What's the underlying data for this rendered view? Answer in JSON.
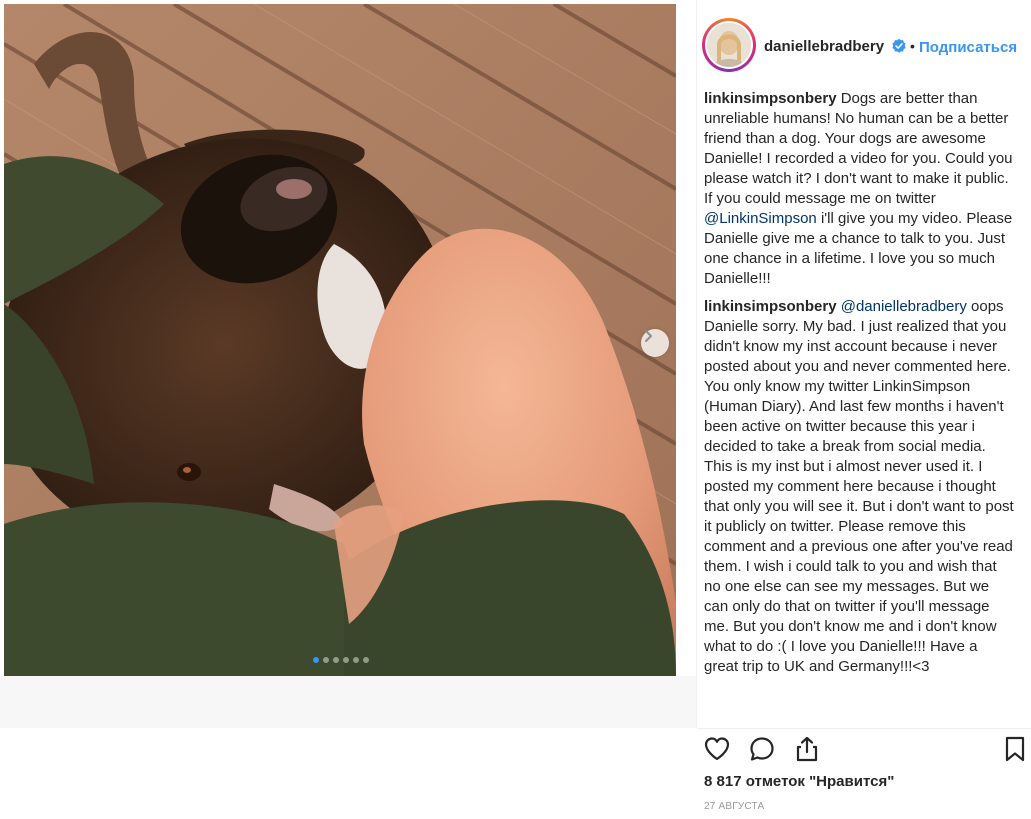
{
  "post": {
    "username": "daniellebradbery",
    "follow_label": "Подписаться",
    "separator": "•",
    "carousel": {
      "slide_count": 6,
      "active_slide": 1
    }
  },
  "comments": [
    {
      "user": "linkinsimpsonbery",
      "text_before": "Dogs are better than unreliable humans! No human can be a better friend than a dog. Your dogs are awesome Danielle! I recorded a video for you. Could you please watch it? I don't want to make it public. If you could message me on twitter ",
      "mention": "@LinkinSimpson",
      "text_after": " i'll give you my video. Please Danielle give me a chance to talk to you. Just one chance in a lifetime. I love you so much Danielle!!!"
    },
    {
      "user": "linkinsimpsonbery",
      "text_before": "",
      "mention": "@daniellebradbery",
      "text_after": " oops Danielle sorry. My bad. I just realized that you didn't know my inst account because i never posted about you and never commented here. You only know my twitter LinkinSimpson (Human Diary). And last few months i haven't been active on twitter because this year i decided to take a break from social media. This is my inst but i almost never used it. I posted my comment here because i thought that only you will see it. But i don't want to post it publicly on twitter. Please remove this comment and a previous one after you've read them. I wish i could talk to you and wish that no one else can see my messages. But we can only do that on twitter if you'll message me. But you don't know me and i don't know what to do :( I love you Danielle!!! Have a great trip to UK and Germany!!!<3"
    }
  ],
  "footer": {
    "likes_text": "8 817 отметок \"Нравится\"",
    "date_text": "27 АВГУСТА"
  },
  "icons": {
    "like": "heart-icon",
    "comment": "comment-bubble-icon",
    "share": "share-icon",
    "save": "bookmark-icon",
    "verified": "verified-badge-icon",
    "next": "chevron-right-icon"
  },
  "colors": {
    "link_blue": "#3897f0",
    "mention_blue": "#003569",
    "active_dot": "#3897f0"
  }
}
